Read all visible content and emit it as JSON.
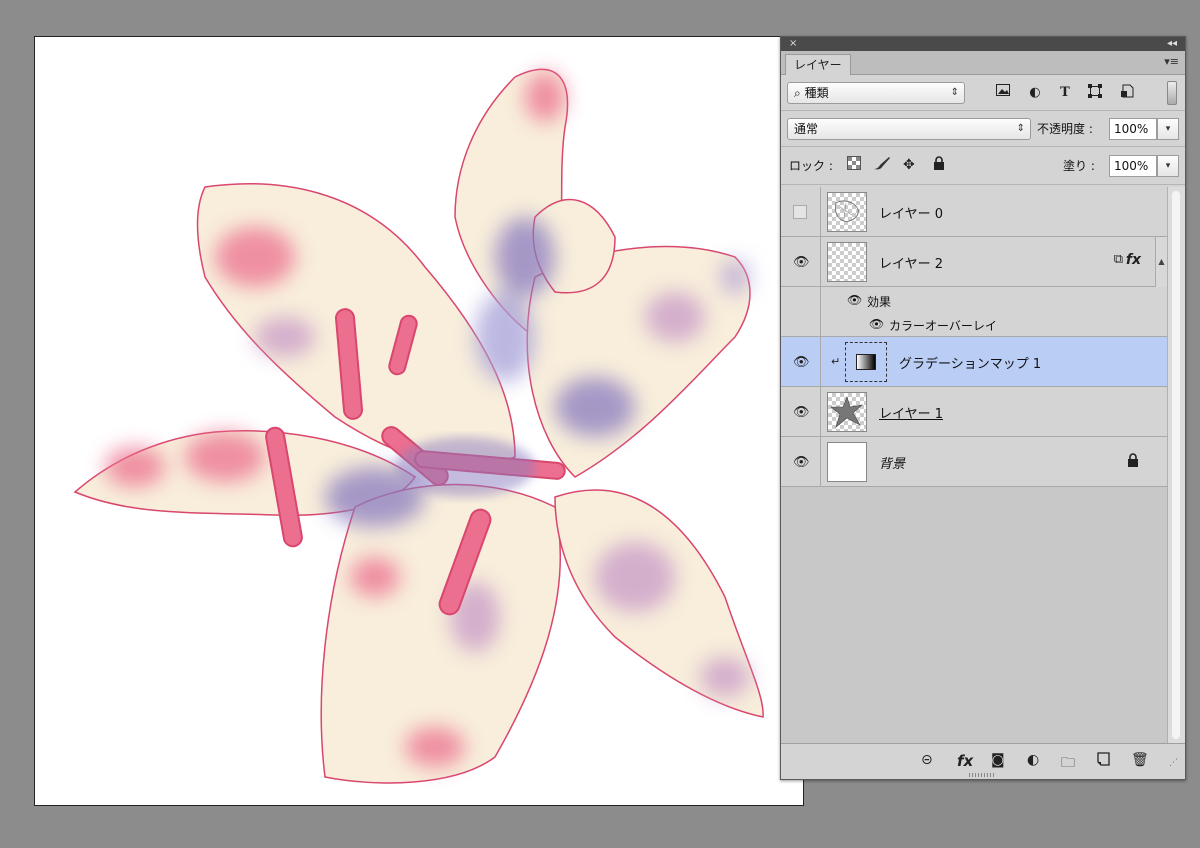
{
  "panel": {
    "close_icon": "×",
    "collapse_icon": "◂◂",
    "tab_label": "レイヤー",
    "menu_icon": "▾≡"
  },
  "filter": {
    "kind_label": "種類",
    "arrows": "⇕"
  },
  "blend": {
    "mode": "通常",
    "opacity_label": "不透明度 :",
    "opacity_value": "100%",
    "fill_label": "塗り :",
    "fill_value": "100%",
    "dropdown_glyph": "▾"
  },
  "lock": {
    "label": "ロック :"
  },
  "layers": [
    {
      "name": "レイヤー 0",
      "visible": false
    },
    {
      "name": "レイヤー 2",
      "visible": true,
      "effects_label": "効果",
      "effect_item": "カラーオーバーレイ"
    },
    {
      "name": "グラデーションマップ 1",
      "visible": true,
      "selected": true
    },
    {
      "name": "レイヤー 1",
      "visible": true
    },
    {
      "name": "背景",
      "visible": true,
      "locked": true
    }
  ],
  "footer": {
    "fx_label": "fx"
  },
  "colors": {
    "selection": "#b9cdf5",
    "petal_base": "#f8eedb",
    "petal_pink": "#ec6f8f",
    "petal_violet": "#8a7cc0"
  }
}
